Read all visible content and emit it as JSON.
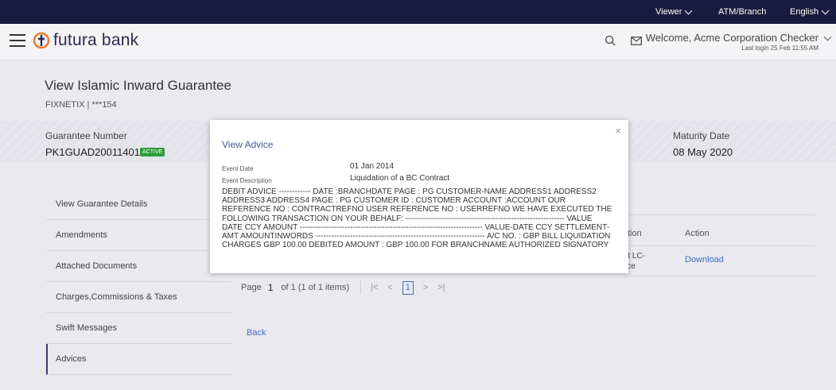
{
  "topbar": {
    "viewer": "Viewer",
    "atm_branch": "ATM/Branch",
    "language": "English"
  },
  "header": {
    "logo_text": "futura bank",
    "welcome": "Welcome, Acme Corporation Checker",
    "last_login": "Last login 25 Feb 11:55 AM"
  },
  "page": {
    "title": "View Islamic Inward Guarantee",
    "subtitle": "FIXNETIX | ***154"
  },
  "guarantee": {
    "number_label": "Guarantee Number",
    "number_value": "PK1GUAD200114011",
    "status": "ACTIVE",
    "maturity_label": "Maturity Date",
    "maturity_value": "08 May 2020"
  },
  "sidebar": {
    "items": [
      {
        "label": "View Guarantee Details"
      },
      {
        "label": "Amendments"
      },
      {
        "label": "Attached Documents"
      },
      {
        "label": "Charges,Commissions & Taxes"
      },
      {
        "label": "Swift Messages"
      },
      {
        "label": "Advices"
      }
    ]
  },
  "table": {
    "col_fragment": "tion",
    "col_action": "Action",
    "row_fragment": "rt LC-\nice",
    "download": "Download"
  },
  "pagination": {
    "page_label": "Page",
    "current": "1",
    "of_text": "of 1  (1 of 1 items)",
    "box": "1"
  },
  "back": "Back",
  "modal": {
    "close": "×",
    "title": "View Advice",
    "event_date_label": "Event Date",
    "event_date_value": "01 Jan 2014",
    "event_desc_label": "Event Description",
    "event_desc_value": "Liquidation of a BC Contract",
    "advice_text": "DEBIT ADVICE ------------ DATE :BRANCHDATE PAGE : PG CUSTOMER-NAME ADDRESS1 ADDRESS2 ADDRESS3 ADDRESS4 PAGE : PG CUSTOMER ID : CUSTOMER ACCOUNT :ACCOUNT OUR REFERENCE NO : CONTRACTREFNO USER REFERENCE NO : USERREFNO WE HAVE EXECUTED THE FOLLOWING TRANSACTION ON YOUR BEHALF: ------------------------------------------------------------ VALUE DATE CCY AMOUNT --------------------------------------------------------------------- VALUE-DATE CCY SETTLEMENT-AMT AMOUNTINWORDS ---------------------------------------------------------------- A/C NO. : GBP BILL LIQUIDATION CHARGES GBP 100.00 DEBITED AMOUNT : GBP 100.00 FOR BRANCHNAME AUTHORIZED SIGNATORY"
  },
  "colors": {
    "topbar_bg": "#1a1a3e",
    "badge_green": "#2a9d3a",
    "link_blue": "#3b6ec5",
    "modal_title": "#4a5a9a"
  }
}
